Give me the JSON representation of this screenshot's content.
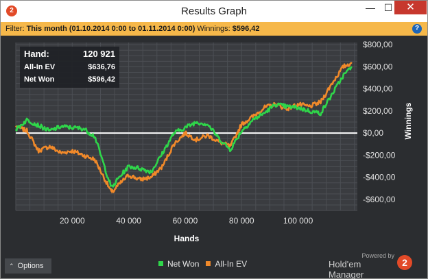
{
  "window": {
    "title": "Results Graph",
    "logo_text": "2",
    "min_glyph": "—",
    "max_glyph": "☐",
    "close_glyph": "✕"
  },
  "filter": {
    "label": "Filter:",
    "period": "This month (01.10.2014 0:00 to 01.11.2014 0:00)",
    "winnings_label": "Winnings:",
    "winnings_value": "$596,42",
    "help_glyph": "?"
  },
  "summary": {
    "rows": [
      {
        "label": "Hand:",
        "value": "120 921"
      },
      {
        "label": "All-In EV",
        "value": "$636,76"
      },
      {
        "label": "Net Won",
        "value": "$596,42"
      }
    ]
  },
  "options": {
    "caret": "⌃",
    "label": "Options"
  },
  "brand": {
    "powered": "Powered by",
    "name": "Hold'em Manager",
    "logo_text": "2"
  },
  "colors": {
    "net_won": "#2fd64a",
    "all_in_ev": "#f0892a",
    "zero_line": "#ffffff",
    "plot_bg": "#3a3c40",
    "grid": "#4c4f54"
  },
  "chart_data": {
    "type": "line",
    "xlabel": "Hands",
    "ylabel": "Winnings",
    "xlim": [
      0,
      121000
    ],
    "ylim": [
      -700,
      820
    ],
    "x_ticks": [
      20000,
      40000,
      60000,
      80000,
      100000
    ],
    "x_tick_labels": [
      "20 000",
      "40 000",
      "60 000",
      "80 000",
      "100 000"
    ],
    "y_ticks": [
      -600,
      -400,
      -200,
      0,
      200,
      400,
      600,
      800
    ],
    "y_tick_labels": [
      "-$600,00",
      "-$400,00",
      "-$200,00",
      "$0,00",
      "$200,00",
      "$400,00",
      "$600,00",
      "$800,00"
    ],
    "grid": true,
    "legend_position": "bottom",
    "x": [
      0,
      4000,
      8000,
      12000,
      16000,
      20000,
      24000,
      28000,
      32000,
      34000,
      36000,
      40000,
      44000,
      48000,
      52000,
      56000,
      60000,
      64000,
      68000,
      72000,
      76000,
      80000,
      84000,
      88000,
      92000,
      96000,
      100000,
      104000,
      108000,
      112000,
      116000,
      119000
    ],
    "series": [
      {
        "name": "Net Won",
        "color_key": "net_won",
        "values": [
          30,
          120,
          70,
          20,
          60,
          50,
          40,
          -30,
          -350,
          -500,
          -420,
          -300,
          -320,
          -350,
          -180,
          0,
          50,
          100,
          80,
          -50,
          -150,
          20,
          120,
          180,
          260,
          240,
          230,
          200,
          180,
          350,
          520,
          600
        ]
      },
      {
        "name": "All-In EV",
        "color_key": "all_in_ev",
        "values": [
          60,
          20,
          -160,
          -120,
          -180,
          -160,
          -200,
          -240,
          -440,
          -540,
          -480,
          -380,
          -420,
          -400,
          -300,
          -100,
          0,
          -60,
          -20,
          -80,
          -120,
          80,
          150,
          230,
          260,
          220,
          260,
          240,
          280,
          450,
          600,
          637
        ]
      }
    ]
  }
}
